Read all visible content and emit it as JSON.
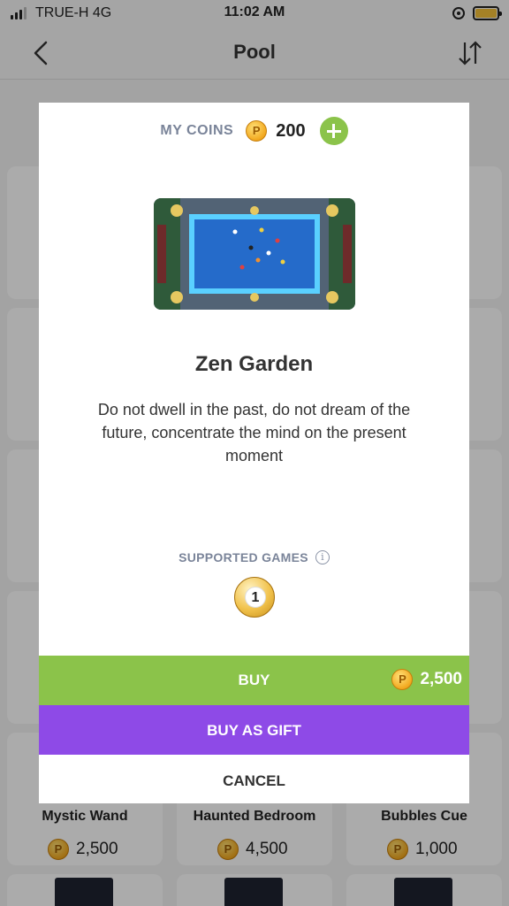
{
  "status_bar": {
    "carrier": "TRUE-H  4G",
    "time": "11:02 AM"
  },
  "nav": {
    "title": "Pool"
  },
  "background_items": [
    {
      "name": "Mystic Wand",
      "price": "2,500"
    },
    {
      "name": "Haunted Bedroom",
      "price": "4,500"
    },
    {
      "name": "Bubbles Cue",
      "price": "1,000"
    }
  ],
  "modal": {
    "coins_label": "MY COINS",
    "coins_value": "200",
    "item_title": "Zen Garden",
    "item_description": "Do not dwell in the past, do not dream of the future, concentrate the mind on the present moment",
    "supported_label": "SUPPORTED GAMES",
    "supported_game_ball": "1",
    "buy_label": "BUY",
    "buy_price": "2,500",
    "gift_label": "BUY AS GIFT",
    "cancel_label": "CANCEL"
  },
  "colors": {
    "buy": "#8bc34a",
    "gift": "#8e4ae7",
    "coin": "#f2a81e"
  }
}
